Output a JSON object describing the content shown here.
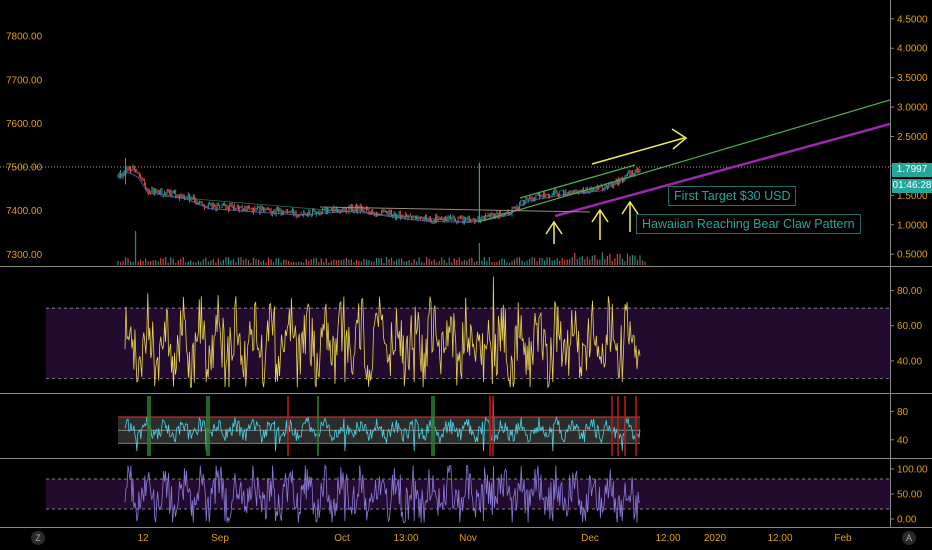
{
  "colors": {
    "background": "#000000",
    "axis_text_left": "#e0a000",
    "axis_text_right": "#e0a000",
    "grid": "#d8d8d8",
    "price": "#d8d8d8",
    "price_up": "#26a69a",
    "price_down": "#ef5350",
    "trend_green": "#4caf50",
    "trend_purple": "#9c27b0",
    "annotation_yellow": "#f2ec5a",
    "osc1": "#e8d44d",
    "osc2": "#4dd0e1",
    "osc3": "#8b7bd8",
    "band_purple": "#2b0e3a",
    "badge_green": "#26a69a"
  },
  "annotations": {
    "first_target": "First Target $30 USD",
    "pattern": "Hawaiian Reaching Bear Claw Pattern"
  },
  "badges": {
    "last_value": "1.7997",
    "countdown": "01:46:28"
  },
  "corner_buttons": {
    "left": "Z",
    "right": "A"
  },
  "chart_data": [
    {
      "type": "line",
      "panel": "price",
      "left_axis": {
        "ticks": [
          7300,
          7400,
          7500,
          7600,
          7700,
          7800
        ],
        "labels": [
          "7300.00",
          "7400.00",
          "7500.00",
          "7600.00",
          "7700.00",
          "7800.00"
        ],
        "ylim": [
          7280,
          7860
        ]
      },
      "right_axis": {
        "ticks": [
          0.5,
          1.0,
          1.5,
          2.0,
          2.5,
          3.0,
          3.5,
          4.0,
          4.5
        ],
        "labels": [
          "0.5000",
          "1.0000",
          "1.5000",
          "2.0000",
          "2.5000",
          "3.0000",
          "3.5000",
          "4.0000",
          "4.5000"
        ],
        "ylim": [
          0.35,
          4.65
        ]
      },
      "x_ticks": [
        "12",
        "Sep",
        "Oct",
        "13:00",
        "Nov",
        "Dec",
        "12:00",
        "2020",
        "12:00",
        "Feb"
      ],
      "grid": true,
      "price_level_line": 7500,
      "series_points": [
        [
          0,
          7480
        ],
        [
          3,
          7500
        ],
        [
          6,
          7445
        ],
        [
          10,
          7440
        ],
        [
          14,
          7430
        ],
        [
          18,
          7410
        ],
        [
          24,
          7405
        ],
        [
          30,
          7400
        ],
        [
          36,
          7395
        ],
        [
          42,
          7400
        ],
        [
          48,
          7405
        ],
        [
          52,
          7395
        ],
        [
          58,
          7385
        ],
        [
          64,
          7380
        ],
        [
          70,
          7378
        ],
        [
          74,
          7385
        ],
        [
          78,
          7395
        ],
        [
          81,
          7425
        ],
        [
          84,
          7432
        ],
        [
          88,
          7440
        ],
        [
          92,
          7445
        ],
        [
          96,
          7450
        ],
        [
          100,
          7470
        ],
        [
          102,
          7485
        ],
        [
          104,
          7495
        ]
      ]
    },
    {
      "type": "line",
      "panel": "oscillator-1",
      "axis": {
        "ticks": [
          40,
          60,
          80
        ],
        "labels": [
          "40.00",
          "60.00",
          "80.00"
        ],
        "ylim": [
          24,
          90
        ]
      },
      "bands": [
        30,
        70
      ],
      "grid": true
    },
    {
      "type": "line",
      "panel": "oscillator-2",
      "axis": {
        "ticks": [
          40,
          80
        ],
        "labels": [
          "40",
          "80"
        ],
        "ylim": [
          20,
          96
        ]
      },
      "bands": [
        35,
        72
      ],
      "grid": true
    },
    {
      "type": "line",
      "panel": "oscillator-3",
      "axis": {
        "ticks": [
          0,
          50,
          100
        ],
        "labels": [
          "0.00",
          "50.00",
          "100.00"
        ],
        "ylim": [
          -8,
          108
        ]
      },
      "bands": [
        20,
        80
      ],
      "grid": true
    }
  ]
}
